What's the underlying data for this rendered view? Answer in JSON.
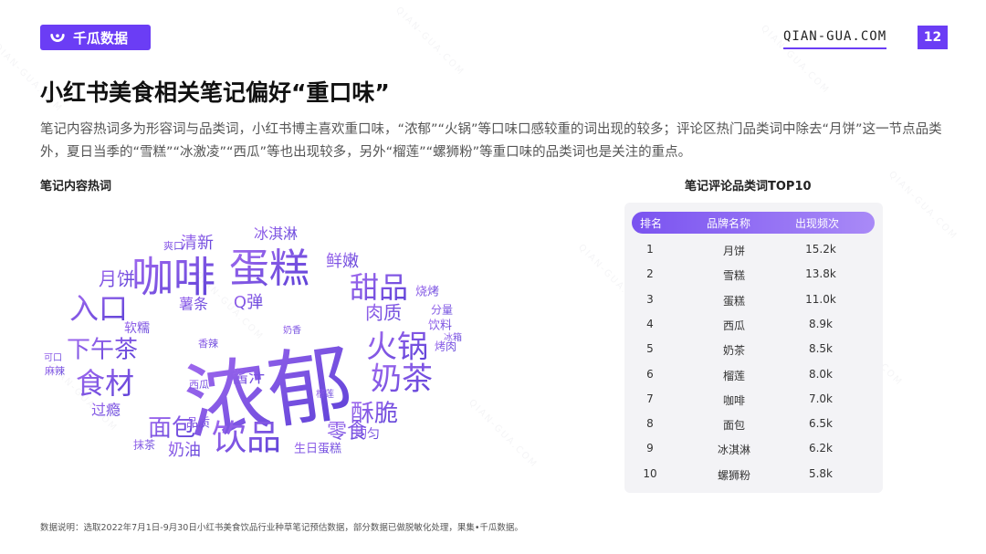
{
  "brand": {
    "logo_text": "千瓜数据",
    "site": "QIAN-GUA.COM",
    "page_number": "12"
  },
  "title": "小红书美食相关笔记偏好“重口味”",
  "description": "笔记内容热词多为形容词与品类词，小红书博主喜欢重口味，“浓郁”“火锅”等口味口感较重的词出现的较多；评论区热门品类词中除去“月饼”这一节点品类外，夏日当季的“雪糕”“冰激凌”“西瓜”等也出现较多，另外“榴莲”“螺狮粉”等重口味的品类词也是关注的重点。",
  "left_section_title": "笔记内容热词",
  "right_section_title": "笔记评论品类词TOP10",
  "word_cloud": {
    "words": [
      "浓郁",
      "咖啡",
      "蛋糕",
      "甜品",
      "火锅",
      "奶茶",
      "饮品",
      "食材",
      "入口",
      "下午茶",
      "面包",
      "酥脆",
      "零食",
      "月饼",
      "鲜嫩",
      "肉质",
      "酱汁",
      "清新",
      "冰淇淋",
      "奶油",
      "Q弹",
      "薯条",
      "过瘾",
      "均匀",
      "软糯",
      "生日蛋糕",
      "饮料",
      "烤肉",
      "烧烤",
      "分量",
      "品质",
      "抹茶",
      "麻辣",
      "西瓜",
      "榴莲",
      "冰箱",
      "爽口",
      "香辣",
      "可口",
      "奶香"
    ]
  },
  "table": {
    "headers": [
      "排名",
      "品牌名称",
      "出现频次"
    ],
    "rows": [
      {
        "rank": "1",
        "name": "月饼",
        "count": "15.2k"
      },
      {
        "rank": "2",
        "name": "雪糕",
        "count": "13.8k"
      },
      {
        "rank": "3",
        "name": "蛋糕",
        "count": "11.0k"
      },
      {
        "rank": "4",
        "name": "西瓜",
        "count": "8.9k"
      },
      {
        "rank": "5",
        "name": "奶茶",
        "count": "8.5k"
      },
      {
        "rank": "6",
        "name": "榴莲",
        "count": "8.0k"
      },
      {
        "rank": "7",
        "name": "咖啡",
        "count": "7.0k"
      },
      {
        "rank": "8",
        "name": "面包",
        "count": "6.5k"
      },
      {
        "rank": "9",
        "name": "冰淇淋",
        "count": "6.2k"
      },
      {
        "rank": "10",
        "name": "螺狮粉",
        "count": "5.8k"
      }
    ]
  },
  "footnote": "数据说明：选取2022年7月1日-9月30日小红书美食饮品行业种草笔记预估数据，部分数据已做脱敏化处理，果集•千瓜数据。",
  "colors": {
    "accent": "#6b3df5",
    "cloud_start": "#9b5de5",
    "cloud_end": "#5b3fd8"
  }
}
